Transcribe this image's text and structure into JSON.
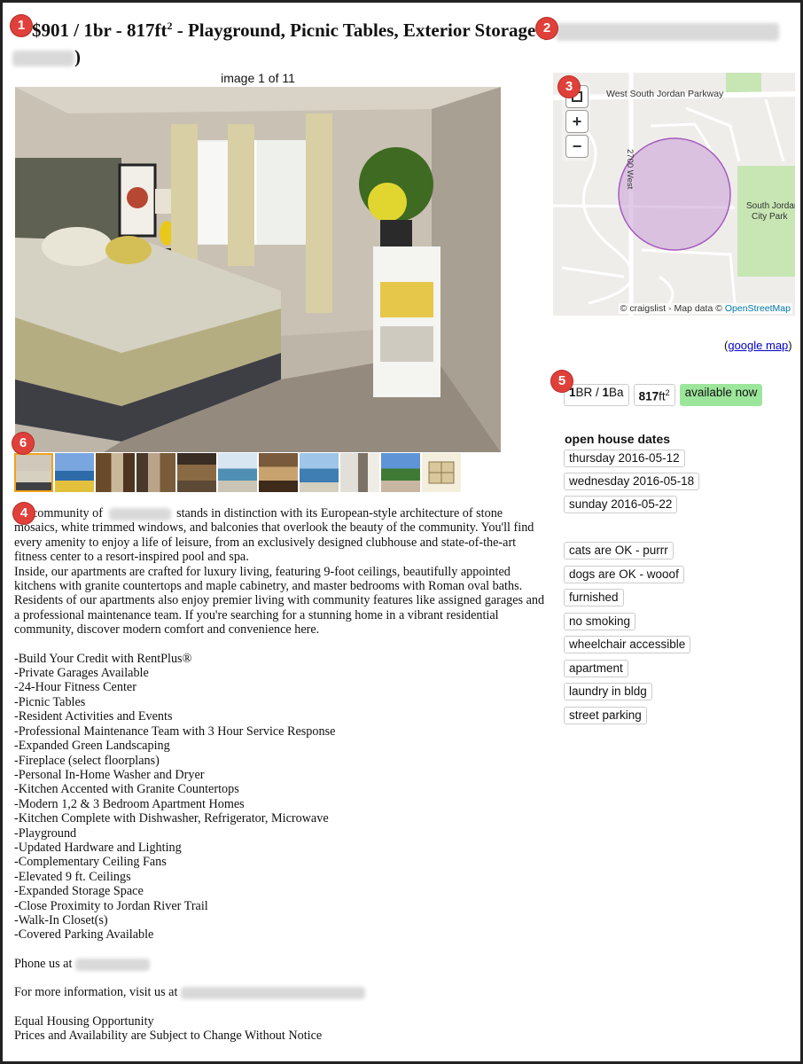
{
  "title": {
    "price": "$901",
    "br": "1br",
    "size": "817ft",
    "size_sup": "2",
    "text": "Playground, Picnic Tables, Exterior Storage"
  },
  "gallery": {
    "counter": "image 1 of 11",
    "thumbnail_count": 11,
    "selected_index": 1
  },
  "description": {
    "para1_start": "community of",
    "para1_rest": "stands in distinction with its European-style architecture of stone mosaics, white trimmed windows, and balconies that overlook the beauty of the community. You'll find every amenity to enjoy a life of leisure, from an exclusively designed clubhouse and state-of-the-art fitness center to a resort-inspired pool and spa.",
    "para2": "Inside, our apartments are crafted for luxury living, featuring 9-foot ceilings, beautifully appointed kitchens with granite countertops and maple cabinetry, and master bedrooms with Roman oval baths. Residents of our apartments also enjoy premier living with community features like assigned garages and a professional maintenance team. If you're searching for a stunning home in a vibrant residential community, discover modern comfort and convenience here.",
    "features": [
      "-Build Your Credit with RentPlus®",
      "-Private Garages Available",
      "-24-Hour Fitness Center",
      "-Picnic Tables",
      "-Resident Activities and Events",
      "-Professional Maintenance Team with 3 Hour Service Response",
      "-Expanded Green Landscaping",
      "-Fireplace (select floorplans)",
      "-Personal In-Home Washer and Dryer",
      "-Kitchen Accented with Granite Countertops",
      "-Modern 1,2 & 3 Bedroom Apartment Homes",
      "-Kitchen Complete with Dishwasher, Refrigerator, Microwave",
      "-Playground",
      "-Updated Hardware and Lighting",
      "-Complementary Ceiling Fans",
      "-Elevated 9 ft. Ceilings",
      "-Expanded Storage Space",
      "-Close Proximity to Jordan River Trail",
      "-Walk-In Closet(s)",
      "-Covered Parking Available"
    ],
    "phone_label": "Phone us at",
    "more_info_label": "For more information, visit us at",
    "eho": "Equal Housing Opportunity",
    "disclaimer": "Prices and Availability are Subject to Change Without Notice"
  },
  "map": {
    "road_label": "West South Jordan Parkway",
    "street_label": "2700 West",
    "park_label_1": "South Jordan",
    "park_label_2": "City Park",
    "attribution": "© craigslist - Map data ©",
    "attribution_link": "OpenStreetMap",
    "zoom_in": "+",
    "zoom_out": "−",
    "fullscreen_icon": "fullscreen-icon",
    "colors": {
      "radius": "#a55dbe",
      "park": "#c8e6b4"
    }
  },
  "google_map": {
    "open": "(",
    "link": "google map",
    "close": ")"
  },
  "attributes": {
    "br": "1",
    "br_unit": "BR / ",
    "ba": "1",
    "ba_unit": "Ba",
    "sqft": "817",
    "sqft_unit": "ft",
    "sqft_sup": "2",
    "availability": "available now"
  },
  "open_house": {
    "heading": "open house dates",
    "dates": [
      "thursday 2016-05-12",
      "wednesday 2016-05-18",
      "sunday 2016-05-22"
    ]
  },
  "amenities": [
    "cats are OK - purrr",
    "dogs are OK - wooof",
    "furnished",
    "no smoking",
    "wheelchair accessible",
    "apartment",
    "laundry in bldg",
    "street parking"
  ],
  "markers": [
    "1",
    "2",
    "3",
    "4",
    "5",
    "6"
  ]
}
